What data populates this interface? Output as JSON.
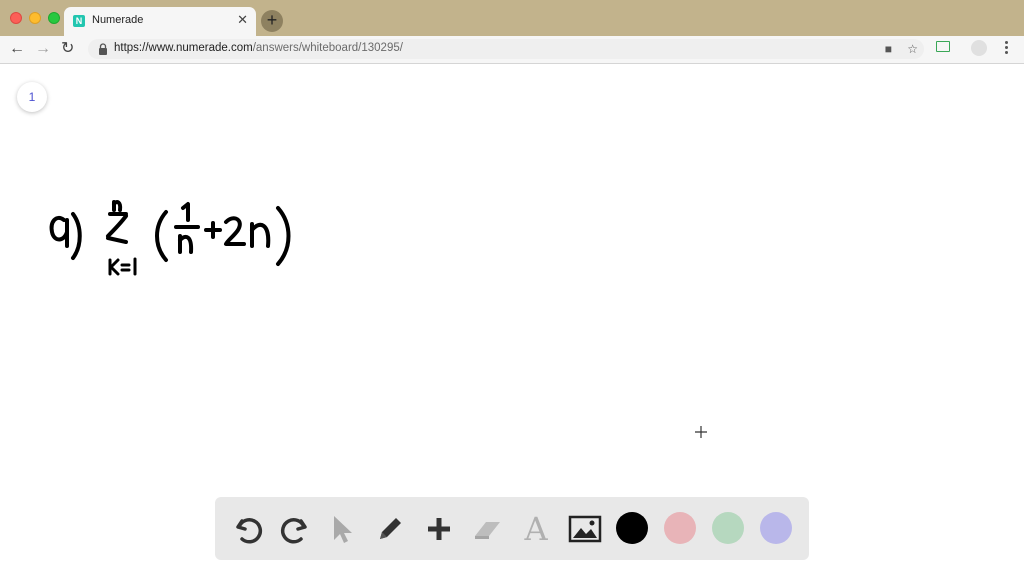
{
  "browser": {
    "tab_title": "Numerade",
    "tab_favicon_letter": "N",
    "url_host": "https://www.numerade.com",
    "url_path": "/answers/whiteboard/130295/"
  },
  "whiteboard": {
    "page_number": "1",
    "handwriting": {
      "label": "a)",
      "sigma_upper": "n",
      "sigma_lower": "k=1",
      "expression": "(1/n + 2n)"
    }
  },
  "palette": {
    "tools": [
      "undo-icon",
      "redo-icon",
      "pointer-icon",
      "pen-icon",
      "plus-icon",
      "eraser-icon",
      "text-icon",
      "image-icon"
    ],
    "colors": [
      "#000000",
      "#e8b4b8",
      "#b6d8bf",
      "#b9b7ea"
    ],
    "text_tool_glyph": "A"
  },
  "colors": {
    "titlebar": "#c2b38c",
    "favicon": "#22c6b0",
    "page_number": "#4a4fd0"
  }
}
